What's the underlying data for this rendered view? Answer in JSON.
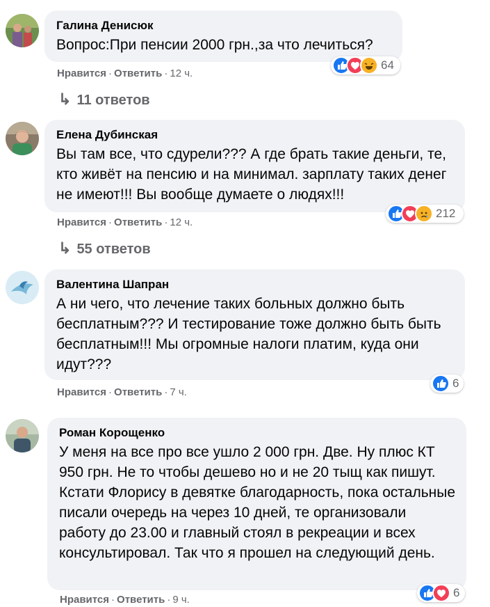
{
  "actions": {
    "like": "Нравится",
    "reply": "Ответить",
    "dot": "·"
  },
  "comments": [
    {
      "author": "Галина Денисюк",
      "text": "Вопрос:При пенсии 2000 грн.,за что лечиться?",
      "time": "12 ч.",
      "reactions": [
        "like",
        "love",
        "haha"
      ],
      "reaction_count": "64",
      "replies_label": "11 ответов"
    },
    {
      "author": "Елена Дубинская",
      "text": "Вы там все, что сдурели??? А где брать такие деньги, те, кто живёт на пенсию и на минимал. зарплату таких денег не имеют!!! Вы вообще думаете о людях!!!",
      "time": "12 ч.",
      "reactions": [
        "like",
        "love",
        "sad"
      ],
      "reaction_count": "212",
      "replies_label": "55 ответов"
    },
    {
      "author": "Валентина Шапран",
      "text": "А ни чего, что лечение таких больных должно быть бесплатным??? И тестирование тоже должно быть быть бесплатным!!! Мы огромные налоги платим, куда они идут???",
      "time": "7 ч.",
      "reactions": [
        "like"
      ],
      "reaction_count": "6"
    },
    {
      "author": "Роман Корощенко",
      "text": "У меня на все про все ушло 2 000 грн. Две. Ну плюс КТ 950 грн. Не то чтобы дешево но и не 20 тыщ как пишут. Кстати Флорису в девятке благодарность, пока остальные писали очередь на через 10 дней, те организовали работу до 23.00 и главный стоял в рекреации и всех консультировал. Так что я прошел на следующий день.",
      "time": "9 ч.",
      "reactions": [
        "like",
        "love"
      ],
      "reaction_count": "6"
    }
  ],
  "colors": {
    "like": "#1877f2",
    "love": "#f33e58",
    "haha": "#f7b125",
    "sad": "#f7b125",
    "bubble": "#f0f2f5",
    "meta": "#65676b"
  }
}
